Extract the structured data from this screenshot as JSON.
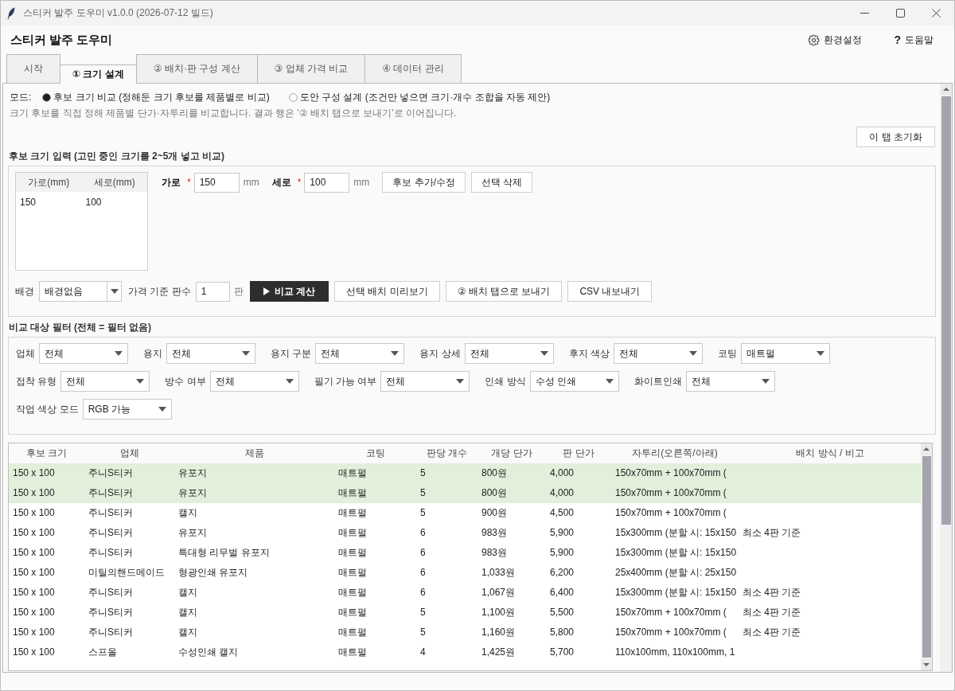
{
  "window": {
    "title": "스티커 발주 도우미 v1.0.0 (2026-07-12 빌드)"
  },
  "header": {
    "title": "스티커 발주 도우미",
    "actions": [
      {
        "kind": "settings",
        "label": "환경설정"
      },
      {
        "kind": "help",
        "icon": "?",
        "label": "도움말"
      }
    ]
  },
  "tabs": [
    {
      "label": "시작",
      "selected": false
    },
    {
      "label": "① 크기 설계",
      "selected": true
    },
    {
      "label": "② 배치·판 구성 계산",
      "selected": false
    },
    {
      "label": "③ 업체 가격 비교",
      "selected": false
    },
    {
      "label": "④ 데이터 관리",
      "selected": false
    }
  ],
  "mode": {
    "label": "모드:",
    "options": [
      {
        "label": "후보 크기 비교 (정해둔 크기 후보를 제품별로 비교)",
        "selected": true
      },
      {
        "label": "도안 구성 설계 (조건만 넣으면 크기·개수 조합을 자동 제안)",
        "selected": false
      }
    ],
    "description": "크기 후보를 직접 정해 제품별 단가·자투리를 비교합니다. 결과 행은 '② 배치 탭으로 보내기'로 이어집니다."
  },
  "reset_button": "이 탭 초기화",
  "candidates": {
    "title": "후보 크기 입력 (고민 중인 크기를 2~5개 넣고 비교)",
    "list": {
      "columns": [
        "가로(mm)",
        "세로(mm)"
      ],
      "rows": [
        [
          "150",
          "100"
        ]
      ]
    },
    "fields": [
      {
        "label": "가로",
        "required_mark": "*",
        "value": "150",
        "unit": "mm"
      },
      {
        "label": "세로",
        "required_mark": "*",
        "value": "100",
        "unit": "mm"
      }
    ],
    "buttons": [
      "후보 추가/수정",
      "선택 삭제"
    ],
    "background": {
      "label": "배경",
      "value": "배경없음"
    },
    "base_sheets": {
      "label": "가격 기준 판수",
      "value": "1",
      "unit": "판"
    },
    "actions": [
      {
        "kind": "primary",
        "label": "비교 계산"
      },
      {
        "kind": "normal",
        "label": "선택 배치 미리보기"
      },
      {
        "kind": "normal",
        "label": "② 배치 탭으로 보내기"
      },
      {
        "kind": "normal",
        "label": "CSV 내보내기"
      }
    ]
  },
  "filters": {
    "title": "비교 대상 필터 (전체 = 필터 없음)",
    "rows": [
      [
        {
          "label": "업체",
          "value": "전체"
        },
        {
          "label": "용지",
          "value": "전체"
        },
        {
          "label": "용지 구분",
          "value": "전체"
        },
        {
          "label": "용지 상세",
          "value": "전체"
        },
        {
          "label": "후지 색상",
          "value": "전체"
        },
        {
          "label": "코팅",
          "value": "매트펄"
        }
      ],
      [
        {
          "label": "접착 유형",
          "value": "전체"
        },
        {
          "label": "방수 여부",
          "value": "전체"
        },
        {
          "label": "필기 가능 여부",
          "value": "전체"
        },
        {
          "label": "인쇄 방식",
          "value": "수성 인쇄"
        },
        {
          "label": "화이트인쇄",
          "value": "전체"
        }
      ],
      [
        {
          "label": "작업 색상 모드",
          "value": "RGB 가능"
        }
      ]
    ]
  },
  "results": {
    "columns": [
      "후보 크기",
      "업체",
      "제품",
      "코팅",
      "판당 개수",
      "개당 단가",
      "판 단가",
      "자투리(오른쪽/아래)",
      "배치 방식 / 비고"
    ],
    "rows": [
      {
        "selected": true,
        "cells": [
          "150 x 100",
          "주니S티커",
          "유포지",
          "매트펄",
          "5",
          "800원",
          "4,000",
          "150x70mm + 100x70mm ("
        ]
      },
      {
        "selected": true,
        "cells": [
          "150 x 100",
          "주니S티커",
          "유포지",
          "매트펄",
          "5",
          "800원",
          "4,000",
          "150x70mm + 100x70mm ("
        ]
      },
      {
        "selected": false,
        "cells": [
          "150 x 100",
          "주니S티커",
          "캘지",
          "매트펄",
          "5",
          "900원",
          "4,500",
          "150x70mm + 100x70mm ("
        ]
      },
      {
        "selected": false,
        "cells": [
          "150 x 100",
          "주니S티커",
          "유포지",
          "매트펄",
          "6",
          "983원",
          "5,900",
          "15x300mm (분할 시: 15x150"
        ],
        "note": "최소 4판 기준"
      },
      {
        "selected": false,
        "cells": [
          "150 x 100",
          "주니S티커",
          "특대형 리무벌 유포지",
          "매트펄",
          "6",
          "983원",
          "5,900",
          "15x300mm (분할 시: 15x150"
        ]
      },
      {
        "selected": false,
        "cells": [
          "150 x 100",
          "미틸의핸드메이드",
          "형광인쇄 유포지",
          "매트펄",
          "6",
          "1,033원",
          "6,200",
          "25x400mm (분할 시: 25x150"
        ]
      },
      {
        "selected": false,
        "cells": [
          "150 x 100",
          "주니S티커",
          "캘지",
          "매트펄",
          "6",
          "1,067원",
          "6,400",
          "15x300mm (분할 시: 15x150"
        ],
        "note": "최소 4판 기준"
      },
      {
        "selected": false,
        "cells": [
          "150 x 100",
          "주니S티커",
          "캘지",
          "매트펄",
          "5",
          "1,100원",
          "5,500",
          "150x70mm + 100x70mm ("
        ],
        "note": "최소 4판 기준"
      },
      {
        "selected": false,
        "cells": [
          "150 x 100",
          "주니S티커",
          "캘지",
          "매트펄",
          "5",
          "1,160원",
          "5,800",
          "150x70mm + 100x70mm ("
        ],
        "note": "최소 4판 기준"
      },
      {
        "selected": false,
        "cells": [
          "150 x 100",
          "스프올",
          "수성인쇄 캘지",
          "매트펄",
          "4",
          "1,425원",
          "5,700",
          "110x100mm, 110x100mm, 1"
        ]
      }
    ]
  }
}
